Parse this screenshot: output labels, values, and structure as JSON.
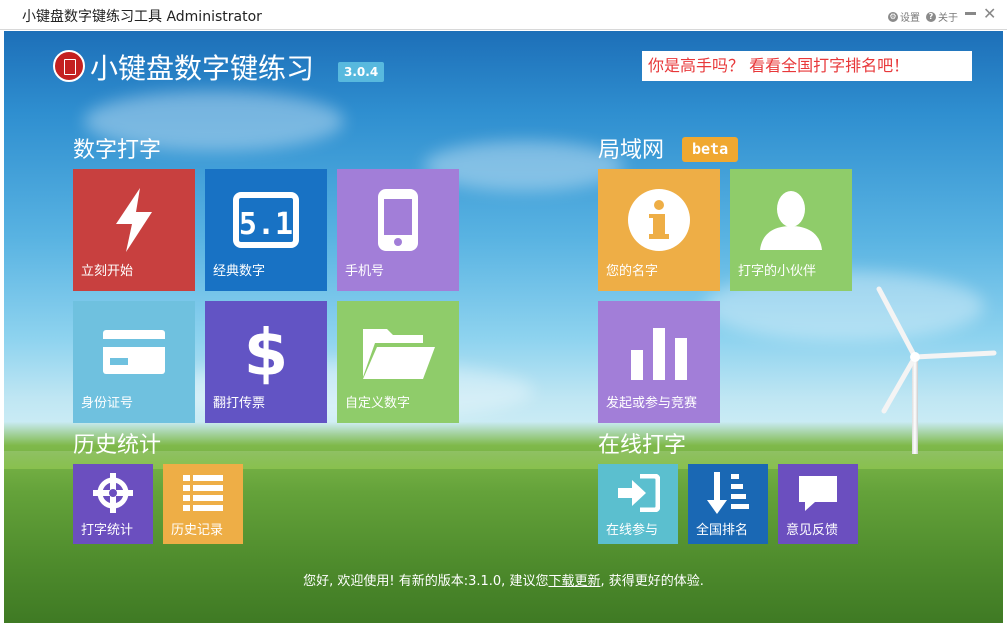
{
  "window": {
    "title": "小键盘数字键练习工具 Administrator",
    "settings_label": "设置",
    "about_label": "关于"
  },
  "header": {
    "app_title": "小键盘数字键练习",
    "version": "3.0.4",
    "promo": "你是高手吗？ 看看全国打字排名吧！"
  },
  "sections": {
    "digital": "数字打字",
    "lan": "局域网",
    "lan_badge": "beta",
    "history": "历史统计",
    "online": "在线打字"
  },
  "tiles": {
    "start_now": "立刻开始",
    "classic": "经典数字",
    "phone": "手机号",
    "id_card": "身份证号",
    "invoice": "翻打传票",
    "custom": "自定义数字",
    "your_name": "您的名字",
    "partners": "打字的小伙伴",
    "compete": "发起或参与竞赛",
    "stats": "打字统计",
    "history_log": "历史记录",
    "online_join": "在线参与",
    "ranking": "全国排名",
    "feedback": "意见反馈"
  },
  "status": {
    "prefix": "您好, 欢迎使用! 有新的版本:3.1.0, 建议您",
    "link": "下载更新",
    "suffix": ", 获得更好的体验."
  },
  "colors": {
    "red": "#c8403f",
    "blue": "#1872c4",
    "purple_light": "#a27ed8",
    "sky": "#6fc1df",
    "purple": "#6254c4",
    "green": "#8fcc6a",
    "orange": "#eeae46",
    "teal": "#5bbfcf",
    "navy": "#1a68b4",
    "violet": "#6b4fbf"
  }
}
